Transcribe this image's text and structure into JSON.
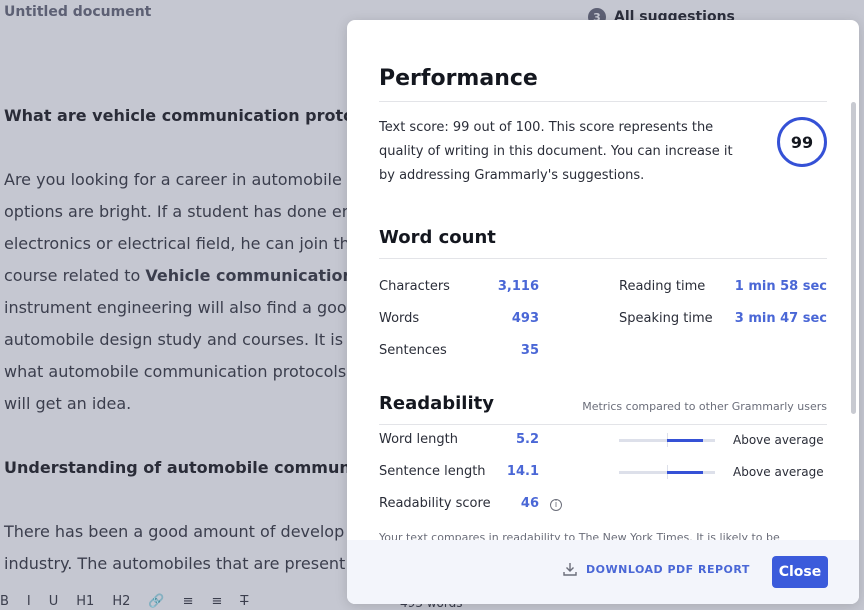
{
  "document": {
    "title": "Untitled document",
    "suggestions_count": "3",
    "suggestions_label": "All suggestions",
    "heading1": "What are vehicle communication protocol",
    "paragraph1": [
      "Are you looking for a career in automobile d",
      "options are bright. If a student has done en",
      "electronics or electrical field, he can join th",
      "course related to ",
      "instrument engineering will also find a good",
      "automobile design study and courses. It is",
      "what automobile communication protocols",
      "will get an idea."
    ],
    "paragraph1_bold_fragment": "Vehicle communication p",
    "heading2": "Understanding of automobile communica",
    "paragraph2": [
      "There has been a good amount of develop",
      "industry. The automobiles that are present"
    ],
    "toolbar": [
      "B",
      "I",
      "U",
      "H1",
      "H2",
      "🔗",
      "≡",
      "≡",
      "T̶"
    ],
    "word_count_label": "493 words"
  },
  "modal": {
    "title": "Performance",
    "score_text": "Text score: 99 out of 100. This score represents the quality of writing in this document. You can increase it by addressing Grammarly's suggestions.",
    "score": "99",
    "word_count_title": "Word count",
    "characters_label": "Characters",
    "characters_value": "3,116",
    "words_label": "Words",
    "words_value": "493",
    "sentences_label": "Sentences",
    "sentences_value": "35",
    "reading_time_label": "Reading time",
    "reading_time_value": "1 min 58 sec",
    "speaking_time_label": "Speaking time",
    "speaking_time_value": "3 min 47 sec",
    "readability_title": "Readability",
    "metrics_note": "Metrics compared to other Grammarly users",
    "word_length_label": "Word length",
    "word_length_value": "5.2",
    "word_length_rating": "Above average",
    "word_length_level": 0.87,
    "sentence_length_label": "Sentence length",
    "sentence_length_value": "14.1",
    "sentence_length_rating": "Above average",
    "sentence_length_level": 0.87,
    "readability_score_label": "Readability score",
    "readability_score_value": "46",
    "readability_cut_text": "Your text compares in readability to The New York Times. It is likely to be",
    "download_label": "DOWNLOAD PDF REPORT",
    "close_label": "Close"
  },
  "colors": {
    "accent": "#3b5bdb",
    "value_blue": "#4a67d6",
    "overlay": "#c5c7d1"
  }
}
